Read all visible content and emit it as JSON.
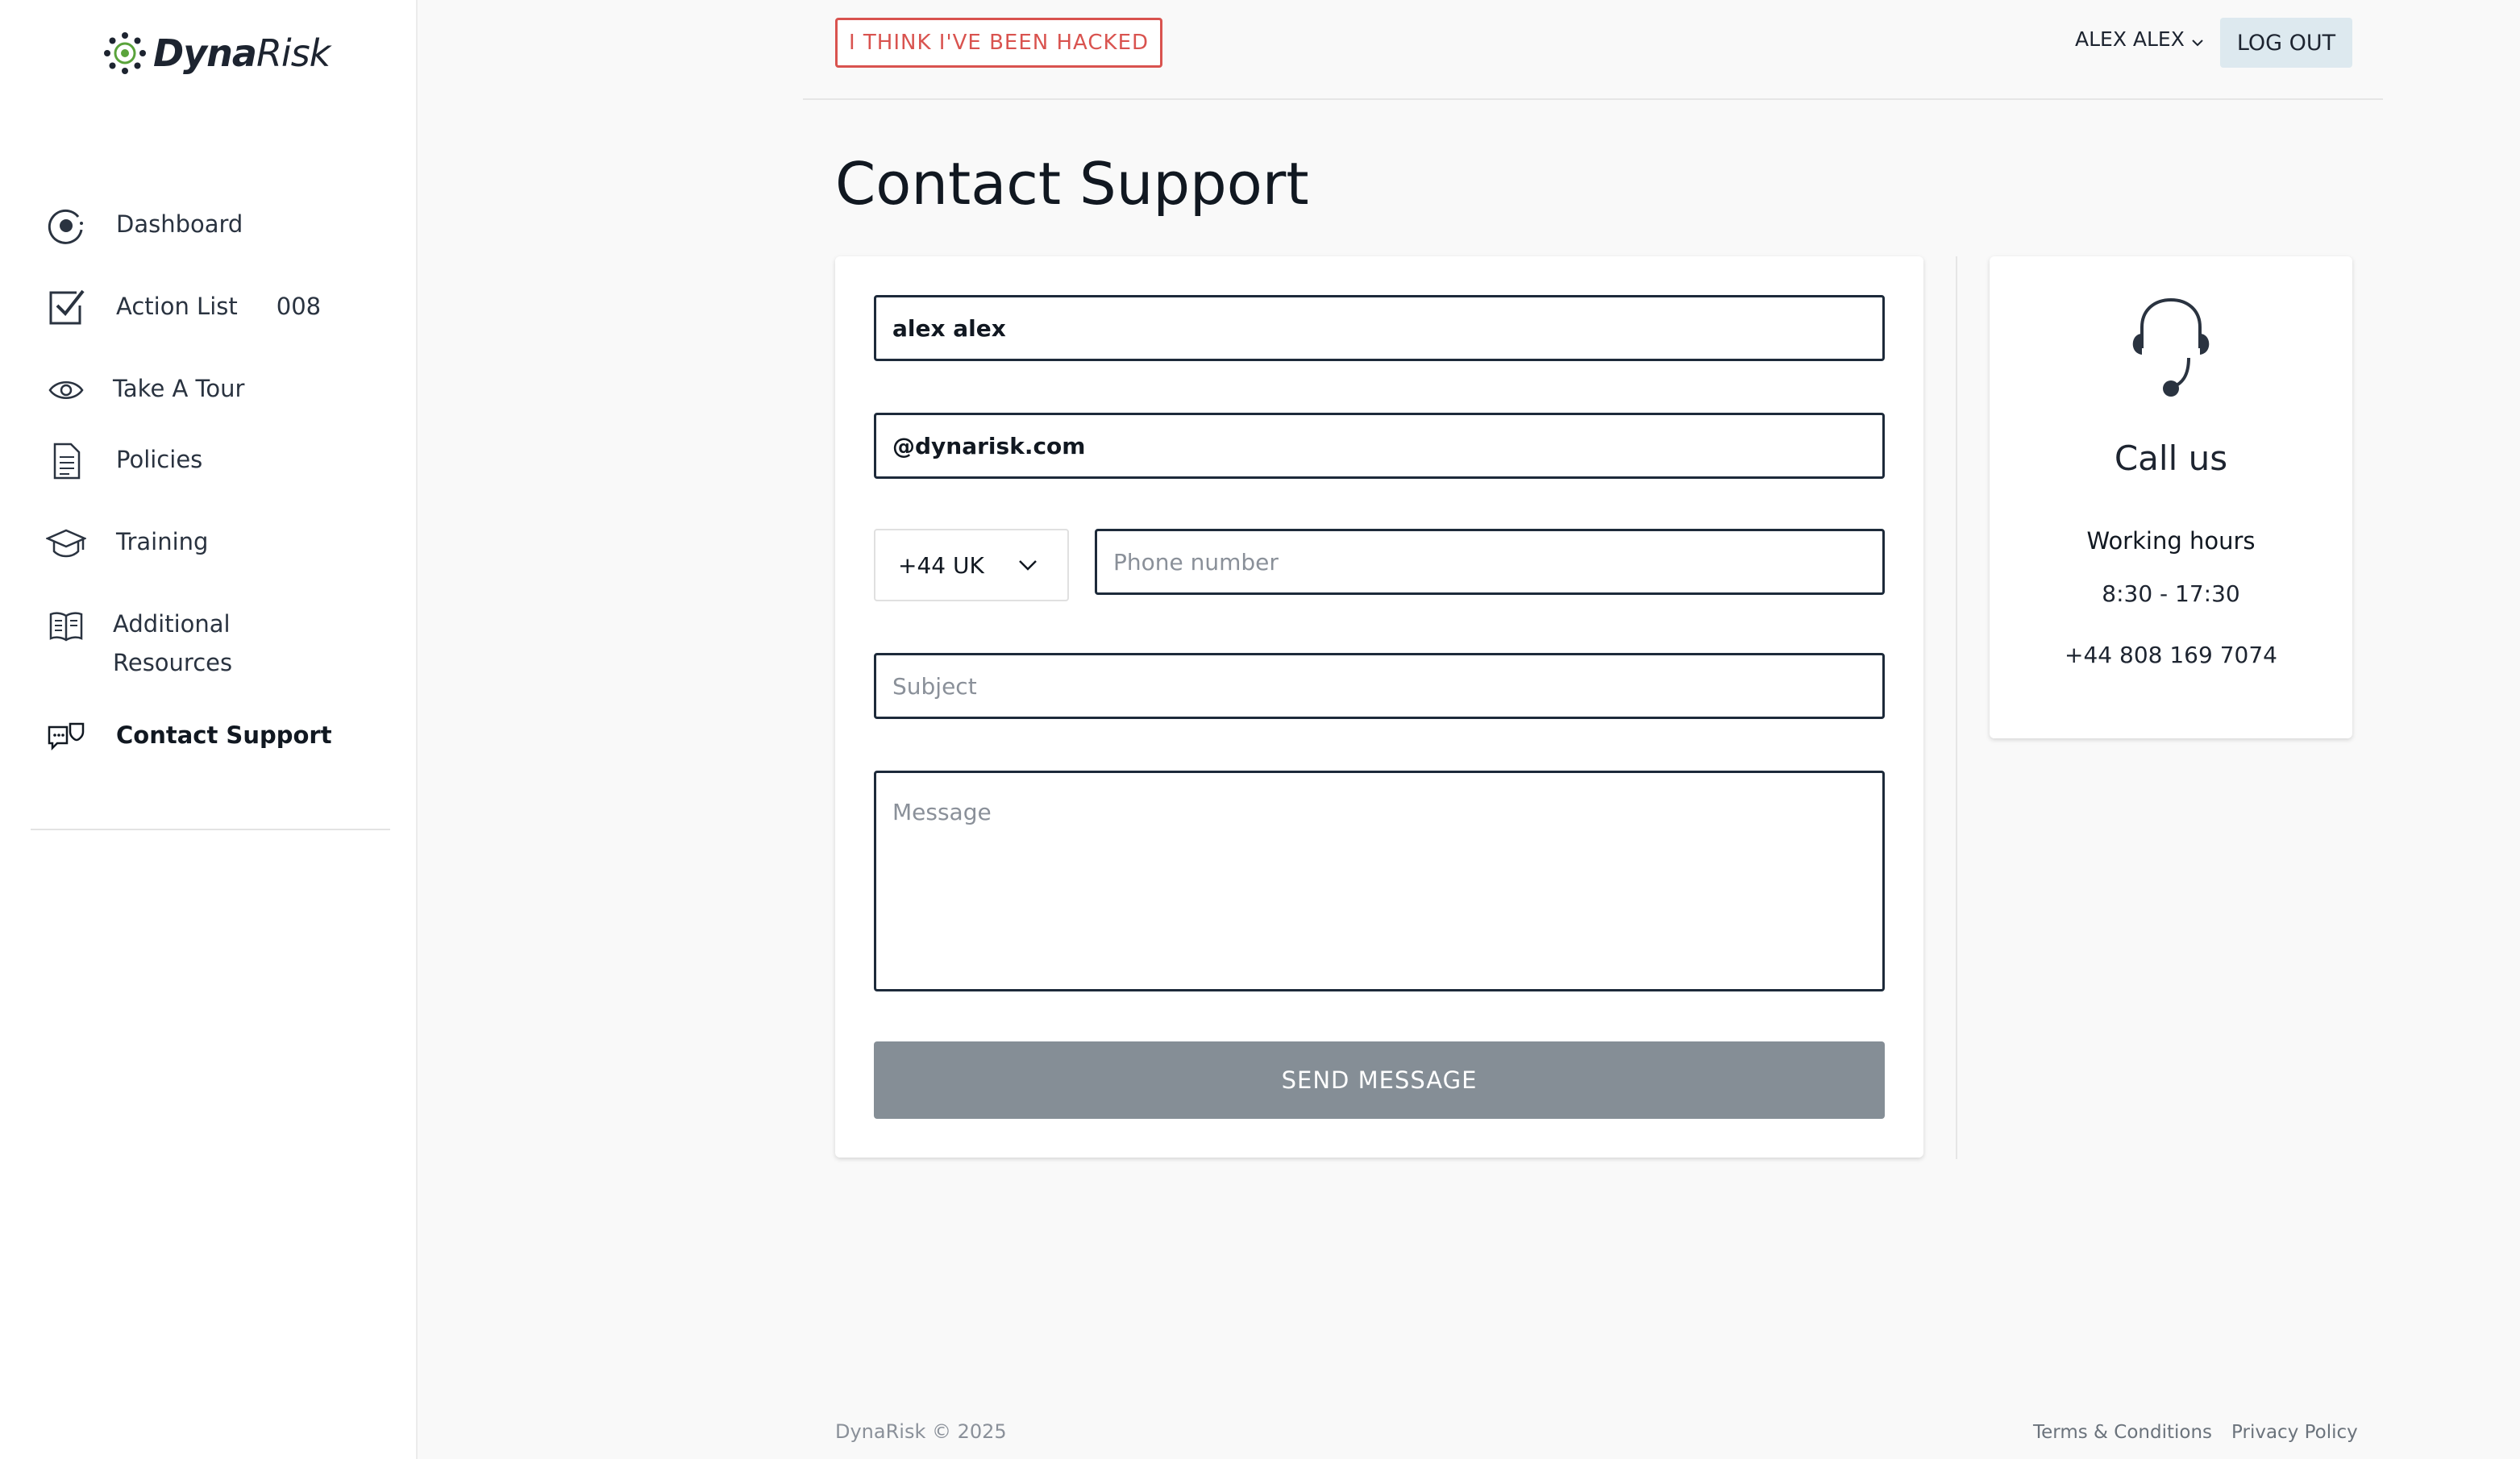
{
  "brand": {
    "name_bold": "Dyna",
    "name_light": "Risk"
  },
  "sidebar": {
    "items": [
      {
        "label": "Dashboard",
        "icon": "dashboard-icon"
      },
      {
        "label": "Action List",
        "count": "008",
        "icon": "checklist-icon"
      },
      {
        "label": "Take A Tour",
        "icon": "eye-icon"
      },
      {
        "label": "Policies",
        "icon": "document-icon"
      },
      {
        "label": "Training",
        "icon": "graduation-cap-icon"
      },
      {
        "label_line1": "Additional",
        "label_line2": "Resources",
        "icon": "book-icon"
      },
      {
        "label": "Contact Support",
        "icon": "support-chat-icon",
        "active": true
      }
    ]
  },
  "header": {
    "hacked_button": "I THINK I'VE BEEN HACKED",
    "user_name": "ALEX ALEX",
    "logout": "LOG OUT"
  },
  "page": {
    "title": "Contact Support"
  },
  "form": {
    "name_value": "alex alex",
    "email_value": "@dynarisk.com",
    "country_code": "+44 UK",
    "phone_placeholder": "Phone number",
    "subject_placeholder": "Subject",
    "message_placeholder": "Message",
    "send_label": "SEND MESSAGE"
  },
  "call_card": {
    "title": "Call us",
    "hours_label": "Working hours",
    "hours_value": "8:30 - 17:30",
    "phone": "+44 808 169 7074"
  },
  "footer": {
    "copyright": "DynaRisk © 2025",
    "terms": "Terms & Conditions",
    "privacy": "Privacy Policy"
  },
  "colors": {
    "accent_danger": "#d9534f",
    "primary_dark": "#1d2a3a",
    "button_disabled": "#858e96",
    "logout_bg": "#dde9ef"
  }
}
